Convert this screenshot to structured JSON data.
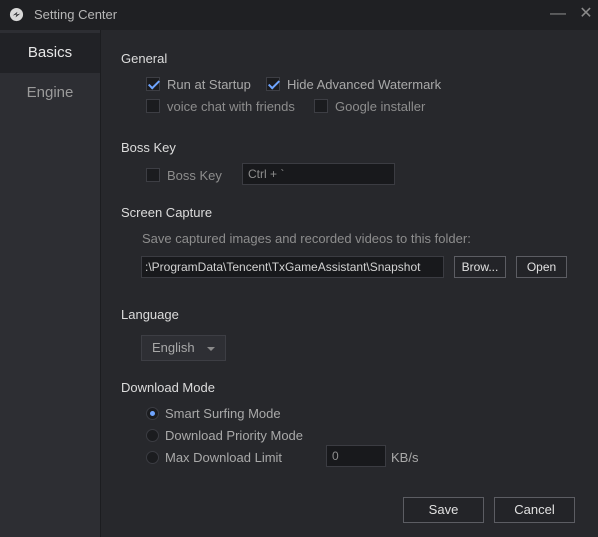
{
  "window": {
    "title": "Setting Center",
    "minimize_glyph": "—",
    "close_glyph": "✕"
  },
  "sidebar": {
    "items": [
      {
        "label": "Basics",
        "active": true
      },
      {
        "label": "Engine",
        "active": false
      }
    ]
  },
  "general": {
    "title": "General",
    "options": [
      {
        "label": "Run at Startup",
        "checked": true
      },
      {
        "label": "Hide Advanced Watermark",
        "checked": true
      },
      {
        "label": "voice chat with friends",
        "checked": false
      },
      {
        "label": "Google installer",
        "checked": false
      }
    ]
  },
  "boss_key": {
    "title": "Boss Key",
    "checkbox_label": "Boss Key",
    "checked": false,
    "shortcut_value": "Ctrl + `"
  },
  "screen_capture": {
    "title": "Screen Capture",
    "description": "Save captured images and recorded videos to this folder:",
    "path_value": ":\\ProgramData\\Tencent\\TxGameAssistant\\Snapshot",
    "browse_label": "Brow...",
    "open_label": "Open"
  },
  "language": {
    "title": "Language",
    "selected": "English"
  },
  "download_mode": {
    "title": "Download Mode",
    "options": [
      {
        "label": "Smart Surfing Mode",
        "selected": true
      },
      {
        "label": "Download Priority Mode",
        "selected": false
      },
      {
        "label": "Max Download Limit",
        "selected": false
      }
    ],
    "limit_value": "0",
    "unit": "KB/s"
  },
  "footer": {
    "save_label": "Save",
    "cancel_label": "Cancel"
  },
  "colors": {
    "accent": "#6fa5ff",
    "background": "#27282c",
    "sidebar": "#2d2e33"
  },
  "icons": {
    "app": "app-logo-icon",
    "minimize": "minimize-icon",
    "close": "close-icon",
    "dropdown": "chevron-down-icon"
  }
}
